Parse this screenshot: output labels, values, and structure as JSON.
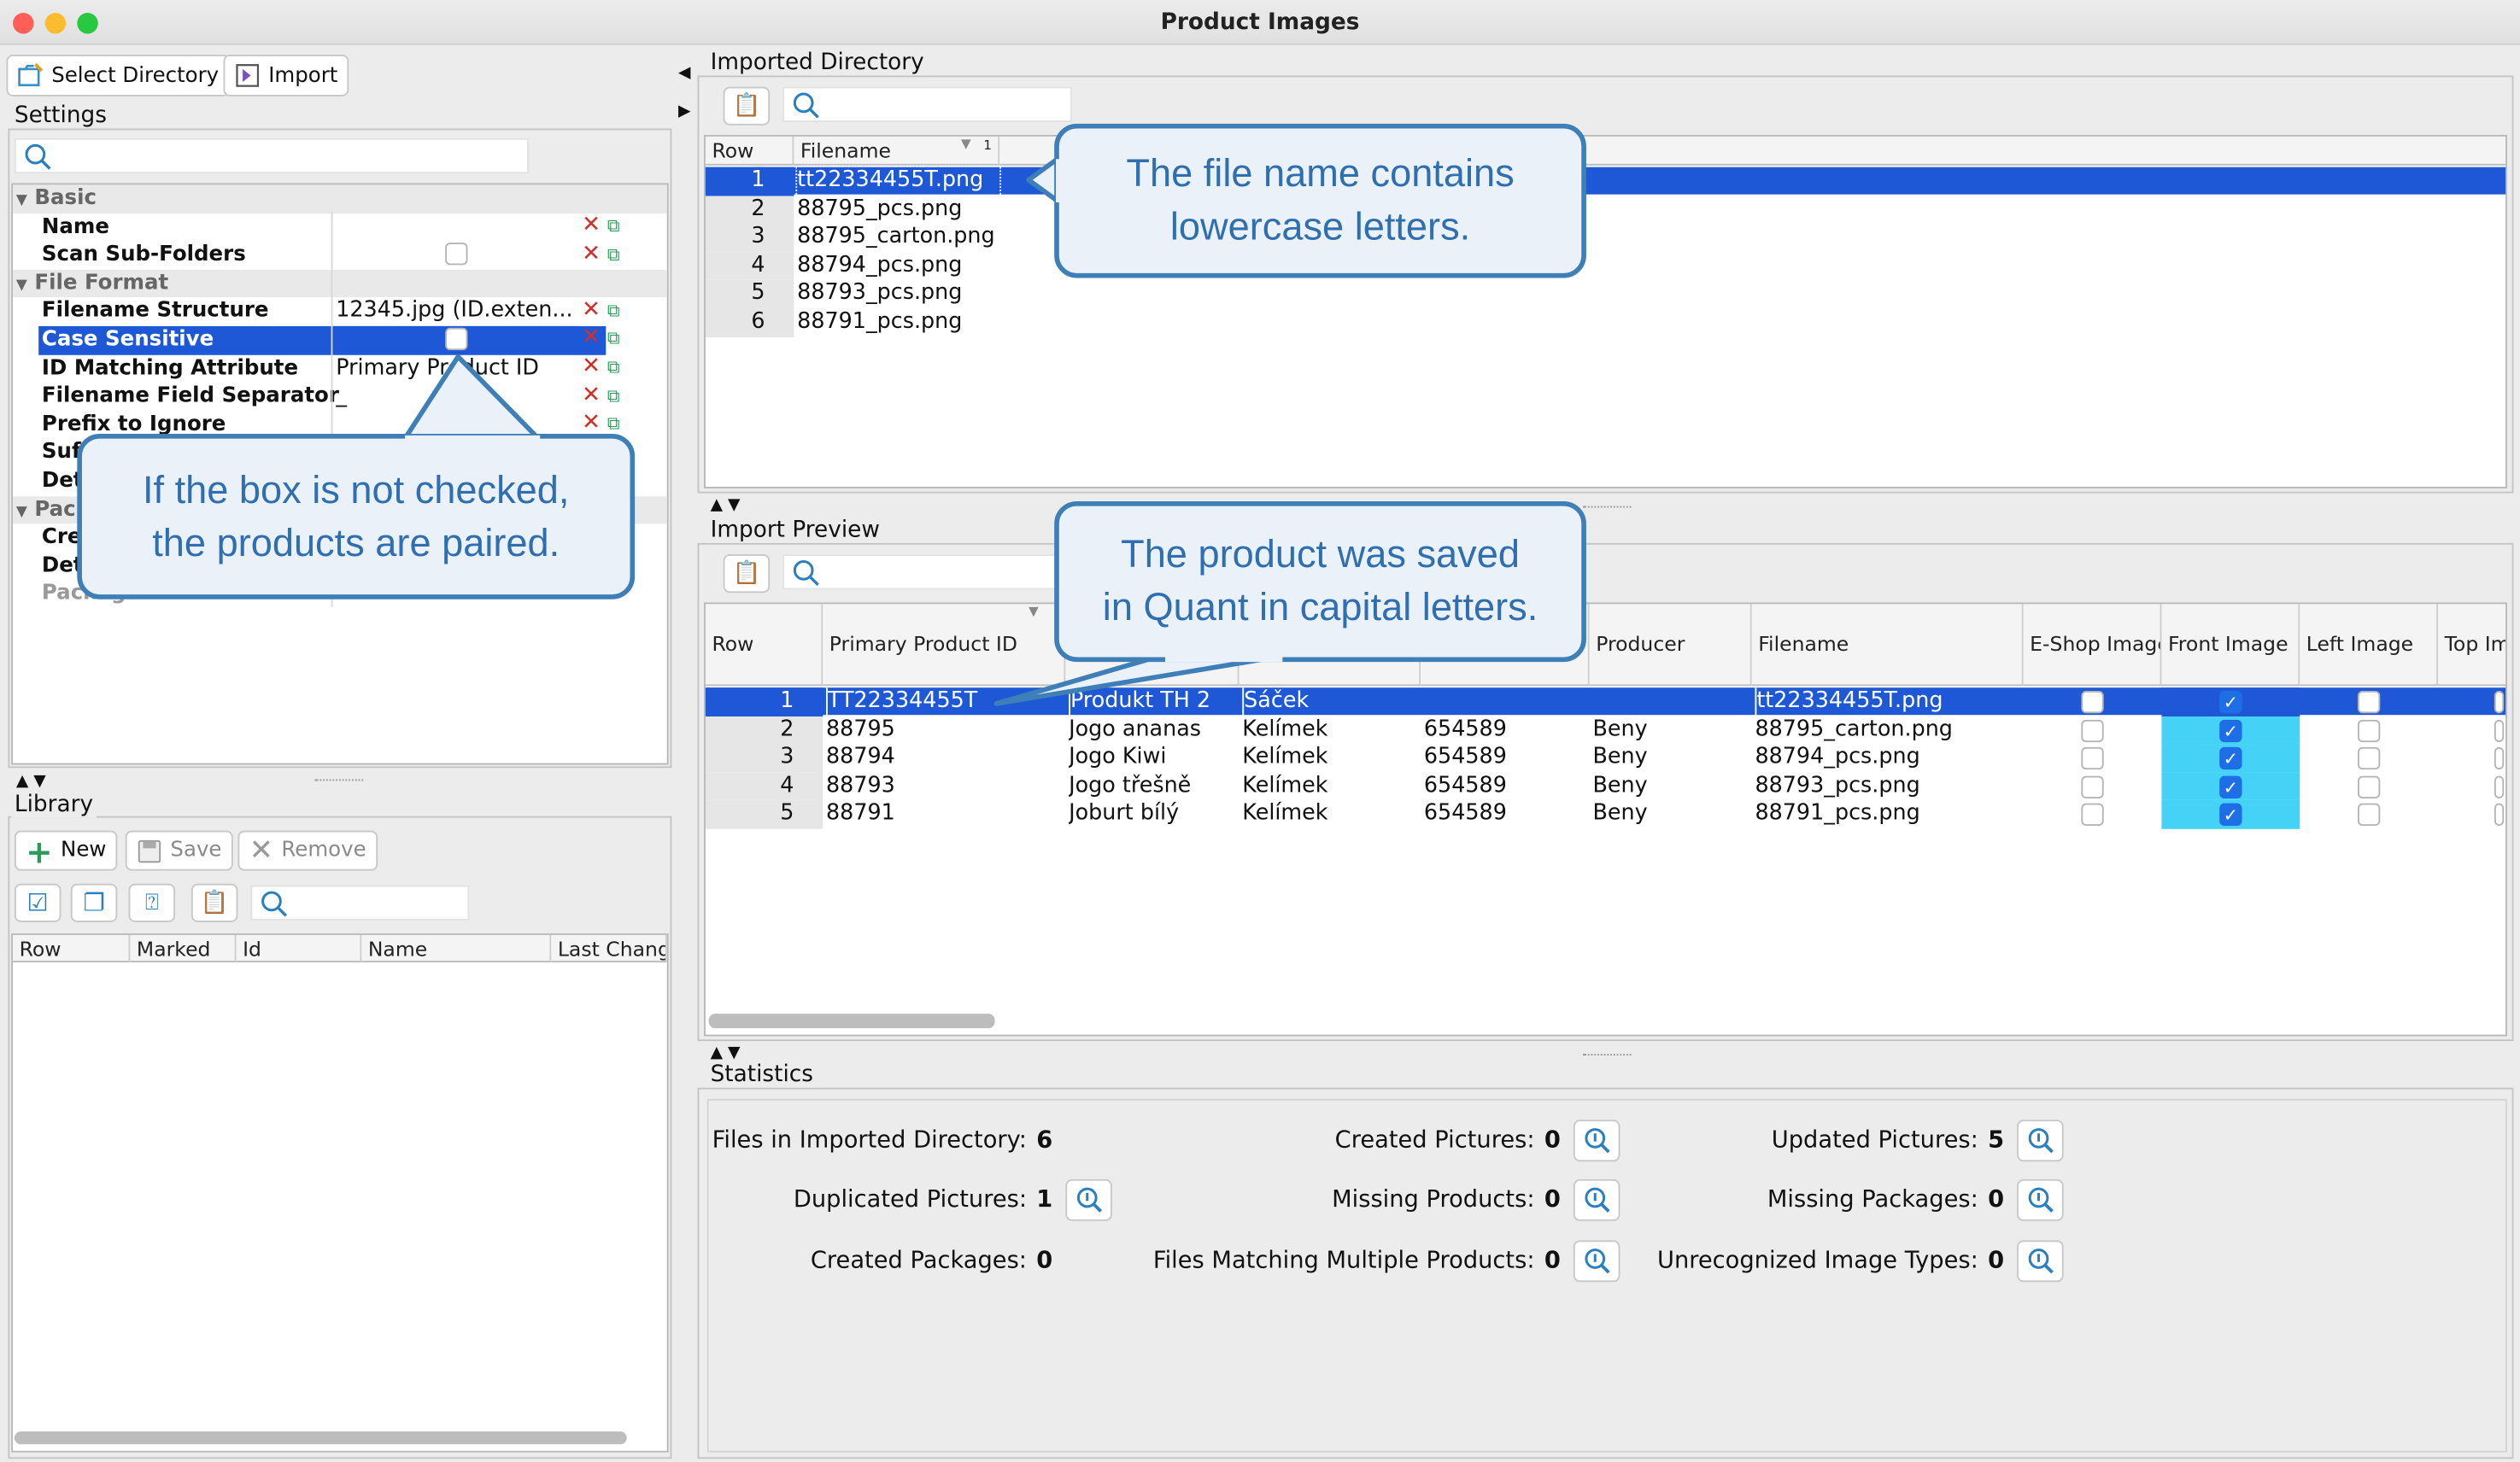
{
  "window": {
    "title": "Product Images"
  },
  "toolbar": {
    "select_directory": "Select Directory",
    "import": "Import"
  },
  "settings": {
    "title": "Settings",
    "groups": {
      "basic": "Basic",
      "file_format": "File Format"
    },
    "rows": [
      {
        "label": "Name",
        "value": ""
      },
      {
        "label": "Scan Sub-Folders",
        "value": ""
      },
      {
        "label": "Filename Structure",
        "value": "12345.jpg (ID.exten..."
      },
      {
        "label": "Case Sensitive",
        "value": ""
      },
      {
        "label": "ID Matching Attribute",
        "value": "Primary Product ID"
      },
      {
        "label": "Filename Field Separator",
        "value": "_"
      },
      {
        "label": "Prefix to Ignore",
        "value": ""
      }
    ],
    "partial_rows": [
      "Suf",
      "Det",
      "Pac",
      "Cre",
      "Det"
    ],
    "package_label": "Package"
  },
  "library": {
    "title": "Library",
    "new": "New",
    "save": "Save",
    "remove": "Remove",
    "columns": [
      "Row",
      "Marked",
      "Id",
      "Name",
      "Last Chang"
    ]
  },
  "imported_directory": {
    "title": "Imported Directory",
    "columns": [
      "Row",
      "Filename"
    ],
    "sort_indicator": "1",
    "rows": [
      {
        "row": "1",
        "filename": "tt22334455T.png"
      },
      {
        "row": "2",
        "filename": "88795_pcs.png"
      },
      {
        "row": "3",
        "filename": "88795_carton.png"
      },
      {
        "row": "4",
        "filename": "88794_pcs.png"
      },
      {
        "row": "5",
        "filename": "88793_pcs.png"
      },
      {
        "row": "6",
        "filename": "88791_pcs.png"
      }
    ]
  },
  "import_preview": {
    "title": "Import Preview",
    "columns": [
      "Row",
      "Primary Product ID",
      "",
      "",
      "",
      "Producer",
      "Filename",
      "E-Shop Image",
      "Front Image",
      "Left Image",
      "Top Im"
    ],
    "rows": [
      {
        "row": "1",
        "id": "TT22334455T",
        "name": "Produkt TH 2",
        "pack": "Sáček",
        "code": "",
        "producer": "",
        "filename": "tt22334455T.png",
        "eshop": false,
        "front": true,
        "left": false
      },
      {
        "row": "2",
        "id": "88795",
        "name": "Jogo ananas",
        "pack": "Kelímek",
        "code": "654589",
        "producer": "Beny",
        "filename": "88795_carton.png",
        "eshop": false,
        "front": true,
        "left": false
      },
      {
        "row": "3",
        "id": "88794",
        "name": "Jogo Kiwi",
        "pack": "Kelímek",
        "code": "654589",
        "producer": "Beny",
        "filename": "88794_pcs.png",
        "eshop": false,
        "front": true,
        "left": false
      },
      {
        "row": "4",
        "id": "88793",
        "name": "Jogo třešně",
        "pack": "Kelímek",
        "code": "654589",
        "producer": "Beny",
        "filename": "88793_pcs.png",
        "eshop": false,
        "front": true,
        "left": false
      },
      {
        "row": "5",
        "id": "88791",
        "name": "Joburt bílý",
        "pack": "Kelímek",
        "code": "654589",
        "producer": "Beny",
        "filename": "88791_pcs.png",
        "eshop": false,
        "front": true,
        "left": false
      }
    ]
  },
  "statistics": {
    "title": "Statistics",
    "items": [
      {
        "label": "Files in Imported Directory:",
        "value": "6"
      },
      {
        "label": "Created Pictures:",
        "value": "0"
      },
      {
        "label": "Updated Pictures:",
        "value": "5"
      },
      {
        "label": "Duplicated Pictures:",
        "value": "1"
      },
      {
        "label": "Missing Products:",
        "value": "0"
      },
      {
        "label": "Missing Packages:",
        "value": "0"
      },
      {
        "label": "Created Packages:",
        "value": "0"
      },
      {
        "label": "Files Matching Multiple Products:",
        "value": "0"
      },
      {
        "label": "Unrecognized Image Types:",
        "value": "0"
      }
    ]
  },
  "callouts": {
    "filename": [
      "The file name contains",
      "lowercase letters."
    ],
    "checkbox": [
      "If the box is not checked,",
      "the products are paired."
    ],
    "product": [
      "The product was saved",
      "in Quant in capital letters."
    ]
  },
  "colors": {
    "selection": "#1e58d6",
    "highlight_cell": "#45d2f7",
    "callout_border": "#3f7fb8",
    "callout_text": "#2f6fb0"
  }
}
